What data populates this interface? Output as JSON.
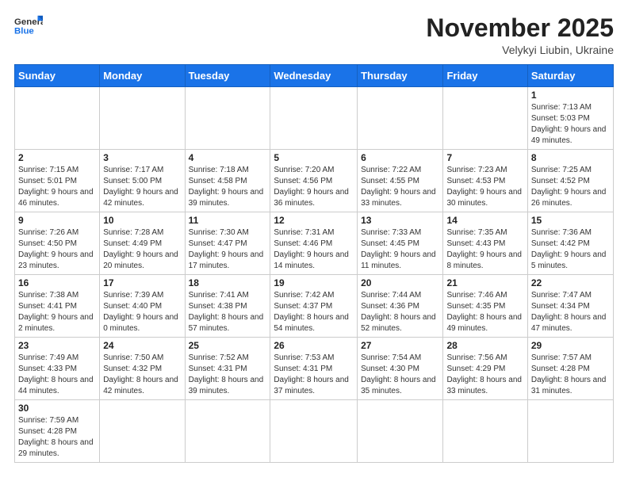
{
  "header": {
    "logo_general": "General",
    "logo_blue": "Blue",
    "month": "November 2025",
    "location": "Velykyi Liubin, Ukraine"
  },
  "weekdays": [
    "Sunday",
    "Monday",
    "Tuesday",
    "Wednesday",
    "Thursday",
    "Friday",
    "Saturday"
  ],
  "weeks": [
    [
      {
        "day": "",
        "info": ""
      },
      {
        "day": "",
        "info": ""
      },
      {
        "day": "",
        "info": ""
      },
      {
        "day": "",
        "info": ""
      },
      {
        "day": "",
        "info": ""
      },
      {
        "day": "",
        "info": ""
      },
      {
        "day": "1",
        "info": "Sunrise: 7:13 AM\nSunset: 5:03 PM\nDaylight: 9 hours and 49 minutes."
      }
    ],
    [
      {
        "day": "2",
        "info": "Sunrise: 7:15 AM\nSunset: 5:01 PM\nDaylight: 9 hours and 46 minutes."
      },
      {
        "day": "3",
        "info": "Sunrise: 7:17 AM\nSunset: 5:00 PM\nDaylight: 9 hours and 42 minutes."
      },
      {
        "day": "4",
        "info": "Sunrise: 7:18 AM\nSunset: 4:58 PM\nDaylight: 9 hours and 39 minutes."
      },
      {
        "day": "5",
        "info": "Sunrise: 7:20 AM\nSunset: 4:56 PM\nDaylight: 9 hours and 36 minutes."
      },
      {
        "day": "6",
        "info": "Sunrise: 7:22 AM\nSunset: 4:55 PM\nDaylight: 9 hours and 33 minutes."
      },
      {
        "day": "7",
        "info": "Sunrise: 7:23 AM\nSunset: 4:53 PM\nDaylight: 9 hours and 30 minutes."
      },
      {
        "day": "8",
        "info": "Sunrise: 7:25 AM\nSunset: 4:52 PM\nDaylight: 9 hours and 26 minutes."
      }
    ],
    [
      {
        "day": "9",
        "info": "Sunrise: 7:26 AM\nSunset: 4:50 PM\nDaylight: 9 hours and 23 minutes."
      },
      {
        "day": "10",
        "info": "Sunrise: 7:28 AM\nSunset: 4:49 PM\nDaylight: 9 hours and 20 minutes."
      },
      {
        "day": "11",
        "info": "Sunrise: 7:30 AM\nSunset: 4:47 PM\nDaylight: 9 hours and 17 minutes."
      },
      {
        "day": "12",
        "info": "Sunrise: 7:31 AM\nSunset: 4:46 PM\nDaylight: 9 hours and 14 minutes."
      },
      {
        "day": "13",
        "info": "Sunrise: 7:33 AM\nSunset: 4:45 PM\nDaylight: 9 hours and 11 minutes."
      },
      {
        "day": "14",
        "info": "Sunrise: 7:35 AM\nSunset: 4:43 PM\nDaylight: 9 hours and 8 minutes."
      },
      {
        "day": "15",
        "info": "Sunrise: 7:36 AM\nSunset: 4:42 PM\nDaylight: 9 hours and 5 minutes."
      }
    ],
    [
      {
        "day": "16",
        "info": "Sunrise: 7:38 AM\nSunset: 4:41 PM\nDaylight: 9 hours and 2 minutes."
      },
      {
        "day": "17",
        "info": "Sunrise: 7:39 AM\nSunset: 4:40 PM\nDaylight: 9 hours and 0 minutes."
      },
      {
        "day": "18",
        "info": "Sunrise: 7:41 AM\nSunset: 4:38 PM\nDaylight: 8 hours and 57 minutes."
      },
      {
        "day": "19",
        "info": "Sunrise: 7:42 AM\nSunset: 4:37 PM\nDaylight: 8 hours and 54 minutes."
      },
      {
        "day": "20",
        "info": "Sunrise: 7:44 AM\nSunset: 4:36 PM\nDaylight: 8 hours and 52 minutes."
      },
      {
        "day": "21",
        "info": "Sunrise: 7:46 AM\nSunset: 4:35 PM\nDaylight: 8 hours and 49 minutes."
      },
      {
        "day": "22",
        "info": "Sunrise: 7:47 AM\nSunset: 4:34 PM\nDaylight: 8 hours and 47 minutes."
      }
    ],
    [
      {
        "day": "23",
        "info": "Sunrise: 7:49 AM\nSunset: 4:33 PM\nDaylight: 8 hours and 44 minutes."
      },
      {
        "day": "24",
        "info": "Sunrise: 7:50 AM\nSunset: 4:32 PM\nDaylight: 8 hours and 42 minutes."
      },
      {
        "day": "25",
        "info": "Sunrise: 7:52 AM\nSunset: 4:31 PM\nDaylight: 8 hours and 39 minutes."
      },
      {
        "day": "26",
        "info": "Sunrise: 7:53 AM\nSunset: 4:31 PM\nDaylight: 8 hours and 37 minutes."
      },
      {
        "day": "27",
        "info": "Sunrise: 7:54 AM\nSunset: 4:30 PM\nDaylight: 8 hours and 35 minutes."
      },
      {
        "day": "28",
        "info": "Sunrise: 7:56 AM\nSunset: 4:29 PM\nDaylight: 8 hours and 33 minutes."
      },
      {
        "day": "29",
        "info": "Sunrise: 7:57 AM\nSunset: 4:28 PM\nDaylight: 8 hours and 31 minutes."
      }
    ],
    [
      {
        "day": "30",
        "info": "Sunrise: 7:59 AM\nSunset: 4:28 PM\nDaylight: 8 hours and 29 minutes."
      },
      {
        "day": "",
        "info": ""
      },
      {
        "day": "",
        "info": ""
      },
      {
        "day": "",
        "info": ""
      },
      {
        "day": "",
        "info": ""
      },
      {
        "day": "",
        "info": ""
      },
      {
        "day": "",
        "info": ""
      }
    ]
  ]
}
